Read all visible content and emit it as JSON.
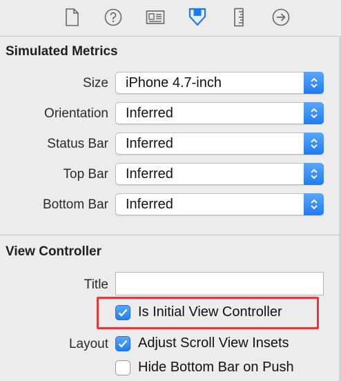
{
  "toolbar": {
    "tabs": [
      {
        "icon": "file-icon",
        "label": "File Inspector"
      },
      {
        "icon": "help-icon",
        "label": "Quick Help Inspector"
      },
      {
        "icon": "identity-icon",
        "label": "Identity Inspector"
      },
      {
        "icon": "attributes-icon",
        "label": "Attributes Inspector"
      },
      {
        "icon": "size-ruler-icon",
        "label": "Size Inspector"
      },
      {
        "icon": "connections-icon",
        "label": "Connections Inspector"
      }
    ],
    "selected": "attributes-icon",
    "accent": "#1a7cf0"
  },
  "simulated_metrics": {
    "heading": "Simulated Metrics",
    "rows": [
      {
        "label": "Size",
        "value": "iPhone 4.7-inch"
      },
      {
        "label": "Orientation",
        "value": "Inferred"
      },
      {
        "label": "Status Bar",
        "value": "Inferred"
      },
      {
        "label": "Top Bar",
        "value": "Inferred"
      },
      {
        "label": "Bottom Bar",
        "value": "Inferred"
      }
    ]
  },
  "view_controller": {
    "heading": "View Controller",
    "title_label": "Title",
    "title_value": "",
    "initial_vc": {
      "label": "Is Initial View Controller",
      "checked": true,
      "highlight_color": "#e8363a"
    },
    "layout_label": "Layout",
    "adjust_scroll": {
      "label": "Adjust Scroll View Insets",
      "checked": true
    },
    "hide_bottom_bar": {
      "label": "Hide Bottom Bar on Push",
      "checked": false
    }
  }
}
